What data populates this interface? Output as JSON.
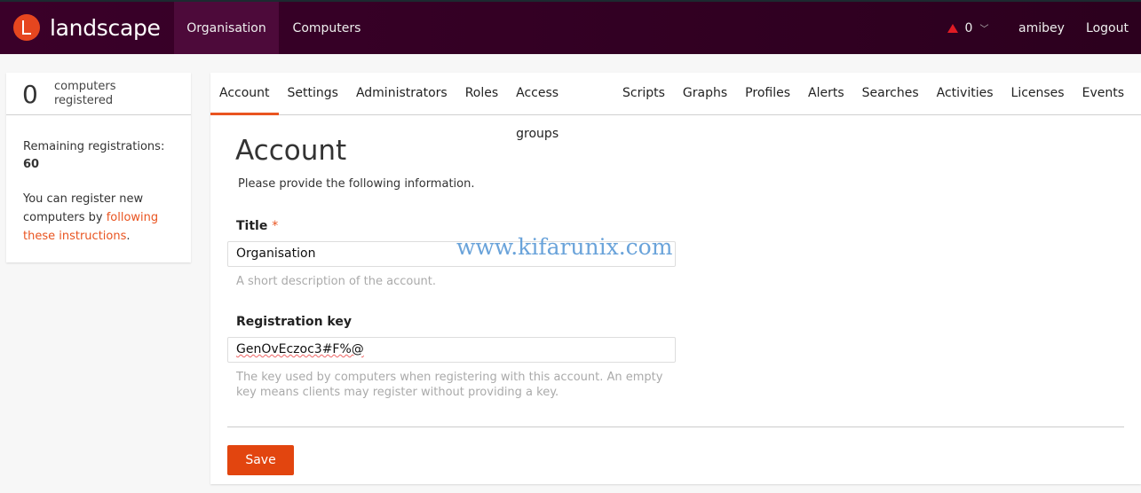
{
  "header": {
    "brand": "landscape",
    "nav": [
      {
        "label": "Organisation",
        "active": true
      },
      {
        "label": "Computers",
        "active": false
      }
    ],
    "alerts_count": "0",
    "user": "amibey",
    "logout": "Logout",
    "alert_color": "#e01b24"
  },
  "sidebar": {
    "count": "0",
    "count_label_1": "computers",
    "count_label_2": "registered",
    "remaining_label": "Remaining registrations:",
    "remaining_value": "60",
    "info_prefix": "You can register new computers by ",
    "info_link": "following these instructions",
    "info_suffix": "."
  },
  "tabs": [
    "Account",
    "Settings",
    "Administrators",
    "Roles",
    "Access groups",
    "Scripts",
    "Graphs",
    "Profiles",
    "Alerts",
    "Searches",
    "Activities",
    "Licenses",
    "Events"
  ],
  "form": {
    "heading": "Account",
    "intro": "Please provide the following information.",
    "title_label": "Title",
    "required_mark": "*",
    "title_value": "Organisation",
    "title_help": "A short description of the account.",
    "key_label": "Registration key",
    "key_value": "GenOvEczoc3#F%@",
    "key_help_1": "The key used by computers when registering with this account. An empty",
    "key_help_2": "key means clients may register without providing a key.",
    "save": "Save"
  },
  "watermark": "www.kifarunix.com",
  "accent": "#e95420"
}
